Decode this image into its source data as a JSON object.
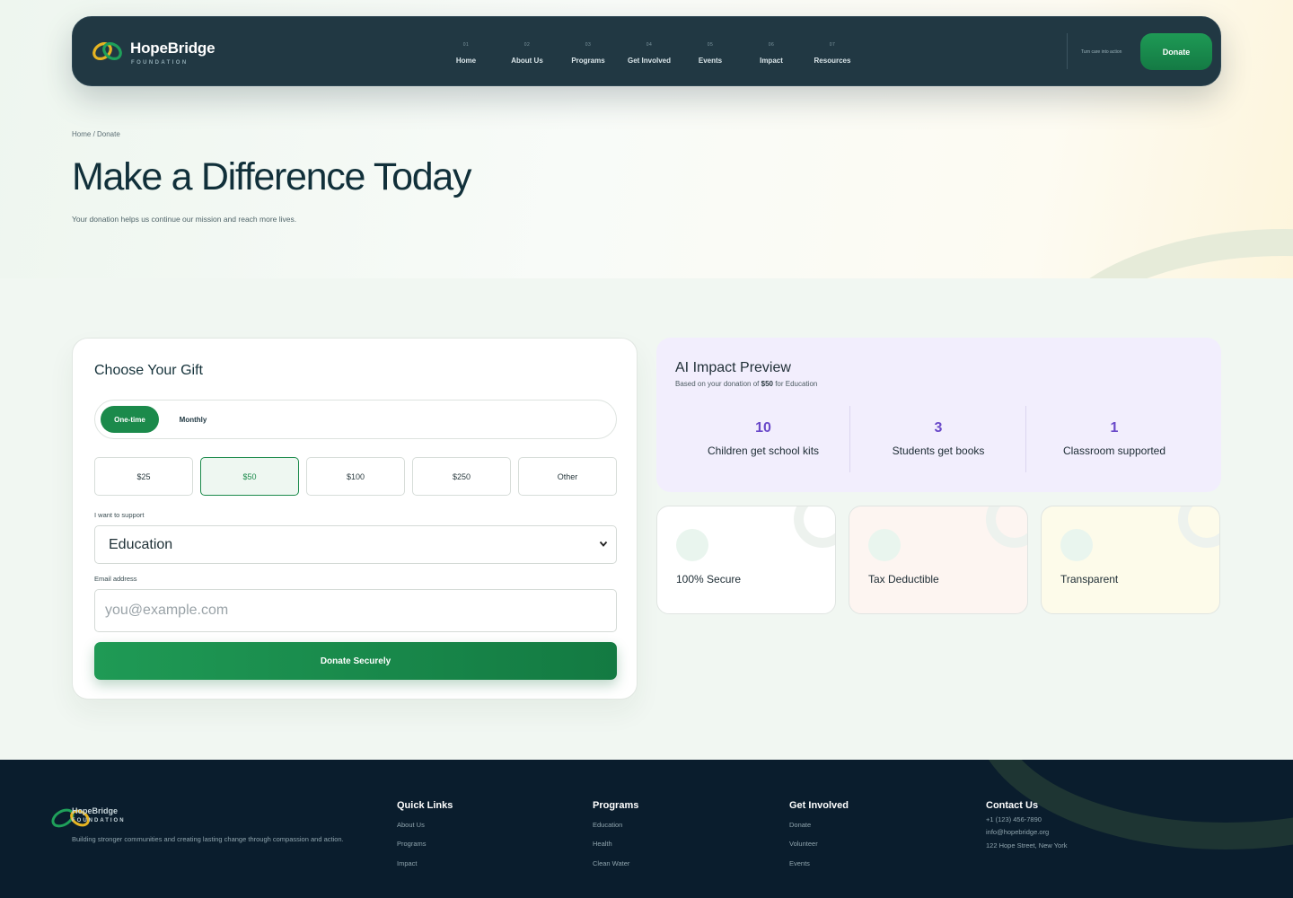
{
  "brand": {
    "name": "HopeBridge",
    "sub": "FOUNDATION",
    "logo_icon": "two-interlinked-rings-green-gold"
  },
  "nav": {
    "items": [
      {
        "num": "01",
        "label": "Home"
      },
      {
        "num": "02",
        "label": "About Us"
      },
      {
        "num": "03",
        "label": "Programs"
      },
      {
        "num": "04",
        "label": "Get Involved"
      },
      {
        "num": "05",
        "label": "Events"
      },
      {
        "num": "06",
        "label": "Impact"
      },
      {
        "num": "07",
        "label": "Resources"
      }
    ],
    "tagline": "Turn care into action",
    "donate_label": "Donate"
  },
  "hero": {
    "breadcrumb": "Home / Donate",
    "title": "Make a Difference Today",
    "subtitle": "Your donation helps us continue our mission and reach more lives."
  },
  "form": {
    "title": "Choose Your Gift",
    "frequency": {
      "options": [
        "One-time",
        "Monthly"
      ],
      "selected": "One-time"
    },
    "amounts": [
      "$25",
      "$50",
      "$100",
      "$250",
      "Other"
    ],
    "selected_amount": "$50",
    "support_label": "I want to support",
    "support_value": "Education",
    "email_label": "Email address",
    "email_placeholder": "you@example.com",
    "submit_label": "Donate Securely"
  },
  "impact": {
    "title": "AI Impact Preview",
    "basis_prefix": "Based on your donation of ",
    "basis_amount": "$50",
    "basis_suffix": " for Education",
    "stats": [
      {
        "value": "10",
        "label": "Children get school kits"
      },
      {
        "value": "3",
        "label": "Students get books"
      },
      {
        "value": "1",
        "label": "Classroom supported"
      }
    ]
  },
  "features": [
    {
      "label": "100% Secure",
      "bg": "#ffffff"
    },
    {
      "label": "Tax Deductible",
      "bg": "#fdf5f1"
    },
    {
      "label": "Transparent",
      "bg": "#fdfbea"
    }
  ],
  "colors": {
    "primary_green": "#1b8a4b",
    "nav_bg": "#213843",
    "impact_purple": "#6a49c9",
    "footer_bg": "#0a1d2d"
  },
  "footer": {
    "brand": "HopeBridge",
    "brand_sub": "FOUNDATION",
    "description": "Building stronger communities and creating lasting change through compassion and action.",
    "columns": [
      {
        "title": "Quick Links",
        "links": [
          "About Us",
          "Programs",
          "Impact"
        ]
      },
      {
        "title": "Programs",
        "links": [
          "Education",
          "Health",
          "Clean Water"
        ]
      },
      {
        "title": "Get Involved",
        "links": [
          "Donate",
          "Volunteer",
          "Events"
        ]
      }
    ],
    "contact": {
      "title": "Contact Us",
      "phone": "+1 (123) 456-7890",
      "email": "info@hopebridge.org",
      "address": "122 Hope Street, New York"
    }
  }
}
